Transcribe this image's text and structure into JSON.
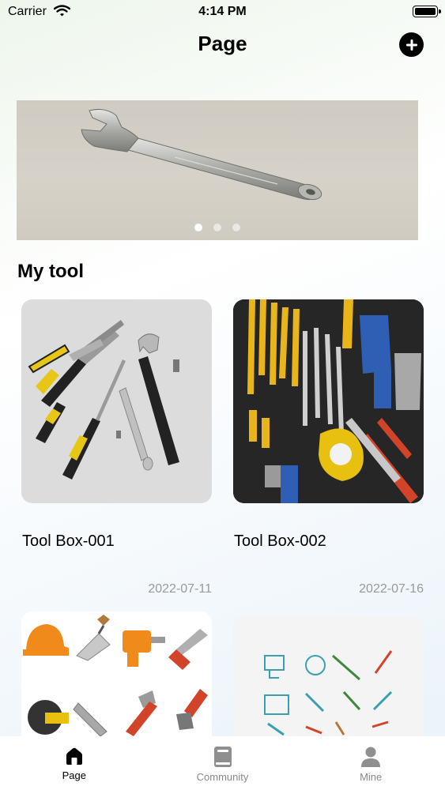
{
  "status_bar": {
    "carrier": "Carrier",
    "time": "4:14 PM"
  },
  "header": {
    "title": "Page",
    "add_icon": "plus-circle-icon"
  },
  "banner": {
    "image": "wrench-photo",
    "page_count": 3,
    "active_page": 1
  },
  "section": {
    "title": "My tool"
  },
  "tools": [
    {
      "name": "Tool Box-001",
      "date": "2022-07-11",
      "image": "pliers-and-wrenches-photo"
    },
    {
      "name": "Tool Box-002",
      "date": "2022-07-16",
      "image": "tool-wall-photo"
    },
    {
      "name": "",
      "date": "",
      "image": "tool-icons-illustration"
    },
    {
      "name": "",
      "date": "",
      "image": "tool-sketch-illustration"
    }
  ],
  "tab_bar": {
    "items": [
      {
        "label": "Page",
        "icon": "home-icon",
        "active": true
      },
      {
        "label": "Community",
        "icon": "book-icon",
        "active": false
      },
      {
        "label": "Mine",
        "icon": "person-icon",
        "active": false
      }
    ]
  },
  "colors": {
    "accent": "#000000",
    "inactive": "#888888",
    "date": "#999999",
    "banner_bg": "#d3cfc6",
    "card4_bg": "#f4f4f4"
  }
}
